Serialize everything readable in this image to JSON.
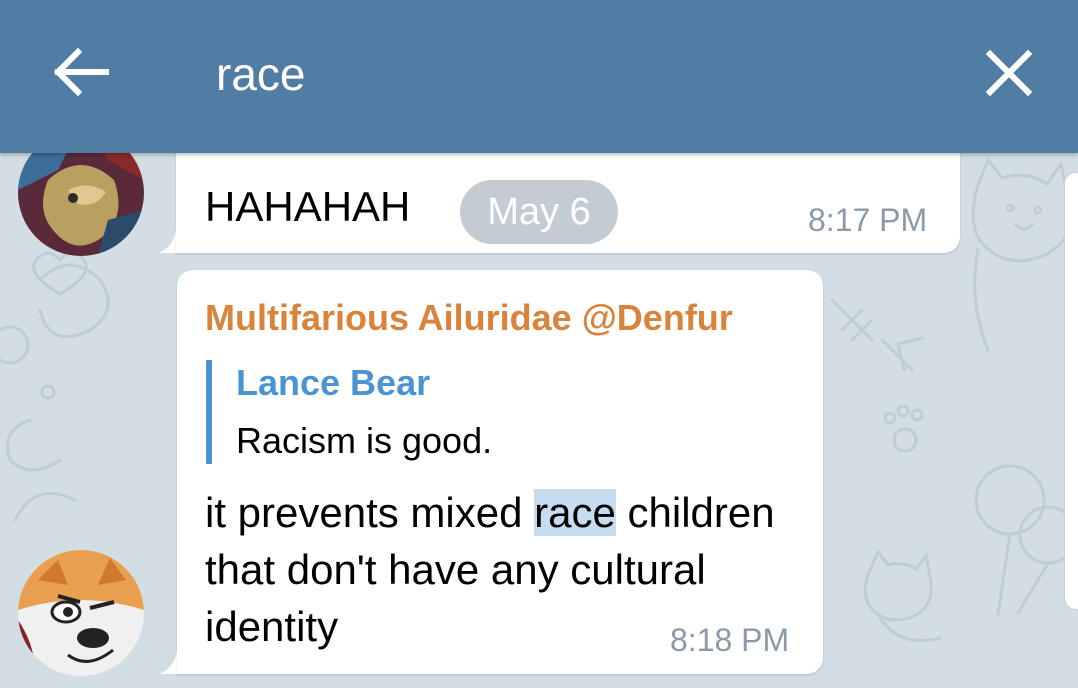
{
  "search": {
    "query": "race"
  },
  "messages": [
    {
      "text": "HAHAHAH",
      "date_badge": "May 6",
      "time": "8:17 PM"
    },
    {
      "sender": "Multifarious Ailuridae @Denfur",
      "reply": {
        "name": "Lance Bear",
        "text": "Racism is good."
      },
      "text_before": "it prevents mixed ",
      "highlight": "race",
      "text_after": " children that don't have any cultural identity",
      "time": "8:18 PM"
    }
  ],
  "colors": {
    "header": "#517ca3",
    "wallpaper": "#d3dde4",
    "sender": "#d9843a",
    "reply": "#4c93d2",
    "highlight": "#c6dcf1",
    "time": "#8a9aa8"
  },
  "icons": [
    "back-arrow-icon",
    "close-icon"
  ]
}
